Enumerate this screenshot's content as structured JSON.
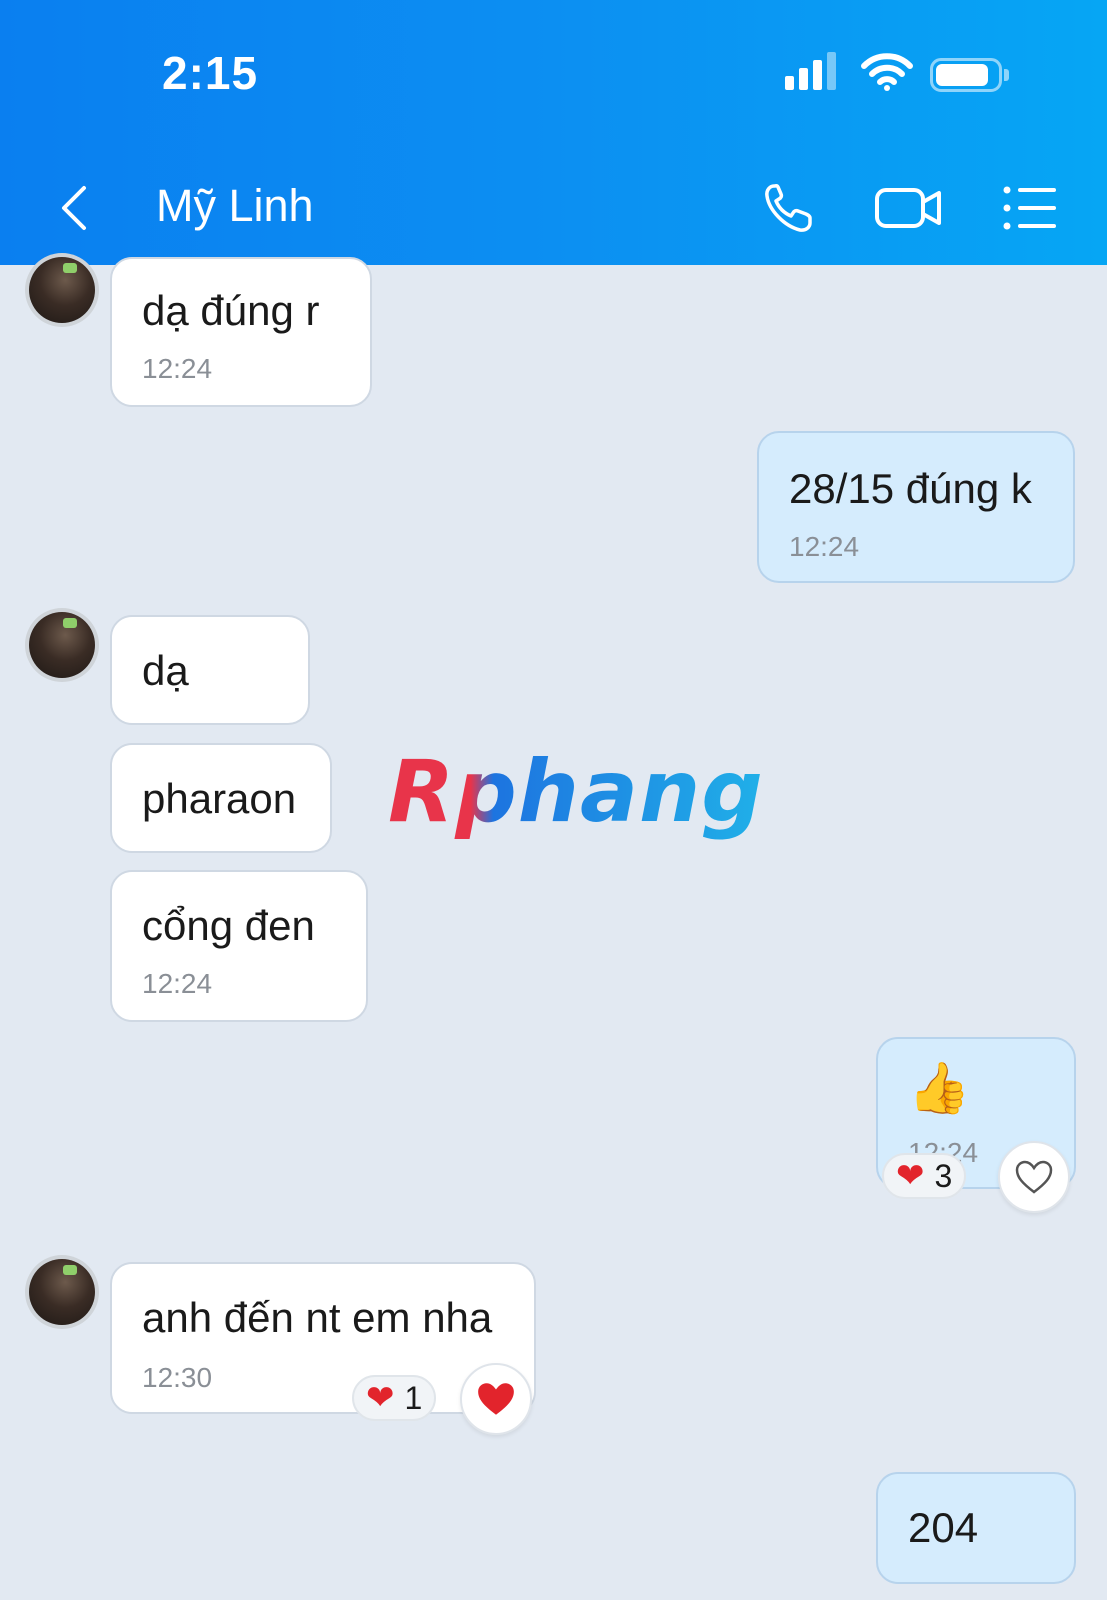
{
  "status_bar": {
    "time": "2:15"
  },
  "header": {
    "contact_name": "Mỹ Linh",
    "icons": {
      "back": "chevron-left-icon",
      "call": "phone-icon",
      "video": "video-camera-icon",
      "menu": "list-menu-icon"
    }
  },
  "watermark": "Rphang",
  "messages": [
    {
      "sender": "contact",
      "text": "dạ đúng r",
      "time": "12:24"
    },
    {
      "sender": "me",
      "text": "28/15 đúng k",
      "time": "12:24"
    },
    {
      "sender": "contact",
      "text": "dạ",
      "time": ""
    },
    {
      "sender": "contact",
      "text": "pharaon",
      "time": ""
    },
    {
      "sender": "contact",
      "text": "cổng đen",
      "time": "12:24"
    },
    {
      "sender": "me",
      "text": "👍",
      "time": "12:24",
      "reaction": {
        "emoji": "❤",
        "count": "3"
      }
    },
    {
      "sender": "contact",
      "text": "anh đến nt em nha",
      "time": "12:30",
      "reaction": {
        "emoji": "❤",
        "count": "1"
      }
    },
    {
      "sender": "me",
      "text": "204",
      "time": ""
    }
  ],
  "colors": {
    "header_start": "#0a7ff0",
    "header_end": "#06a6f4",
    "chat_background": "#e2e9f2",
    "outgoing_bubble": "#d5ecfd",
    "incoming_bubble": "#ffffff",
    "heart": "#e2242c"
  }
}
